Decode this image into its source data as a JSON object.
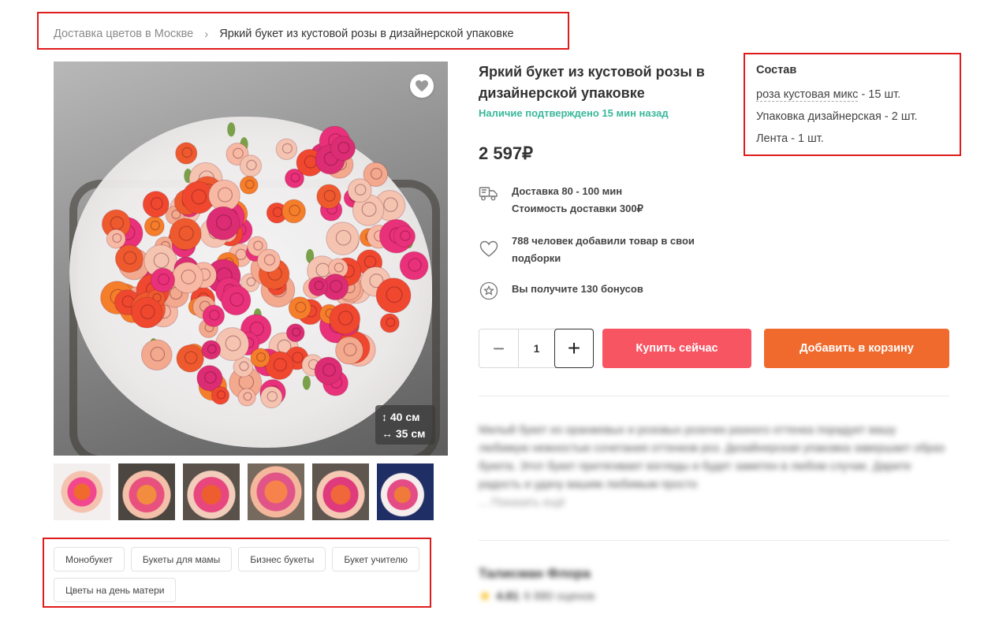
{
  "breadcrumb": {
    "parent": "Доставка цветов в Москве",
    "separator": "›",
    "current": "Яркий букет из кустовой розы в дизайнерской упаковке"
  },
  "product": {
    "title": "Яркий букет из кустовой розы в дизайнерской упаковке",
    "availability": "Наличие подтверждено 15 мин назад",
    "price": "2 597₽",
    "size": {
      "height": "↕ 40 см",
      "width": "↔ 35 см"
    }
  },
  "features": {
    "delivery_time": "Доставка 80 - 100 мин",
    "delivery_cost": "Стоимость доставки 300₽",
    "favorites": "788 человек добавили товар в свои подборки",
    "bonus": "Вы получите 130 бонусов"
  },
  "composition": {
    "title": "Состав",
    "items": [
      {
        "name": "роза кустовая микс",
        "qty": " - 15 шт."
      },
      {
        "name": "Упаковка дизайнерская",
        "qty": " - 2 шт."
      },
      {
        "name": "Лента",
        "qty": " - 1 шт."
      }
    ]
  },
  "purchase": {
    "quantity": "1",
    "minus": "−",
    "plus": "+",
    "buy_now": "Купить сейчас",
    "add_to_cart": "Добавить в корзину"
  },
  "description": {
    "text": "Милый букет из оранжевых и розовых розочек разного оттенка порадует вашу любимую нежностью сочетания оттенков роз. Дизайнерская упаковка завершает образ букета. Этот букет притягивает взгляды и будет заметен в любом случае. Дарите радость и удачу вашим любимым просто",
    "more": "... Показать ещё"
  },
  "shop": {
    "name": "Талисман Флора",
    "rating": "4.81",
    "reviews": "6 880 оценок"
  },
  "tags": [
    "Монобукет",
    "Букеты для мамы",
    "Бизнес букеты",
    "Букет учителю",
    "Цветы на день матери"
  ],
  "colors": {
    "accent_green": "#3ab79b",
    "buy_button": "#f85563",
    "cart_button": "#f06a2d",
    "annotation_border": "#e01b1b"
  }
}
